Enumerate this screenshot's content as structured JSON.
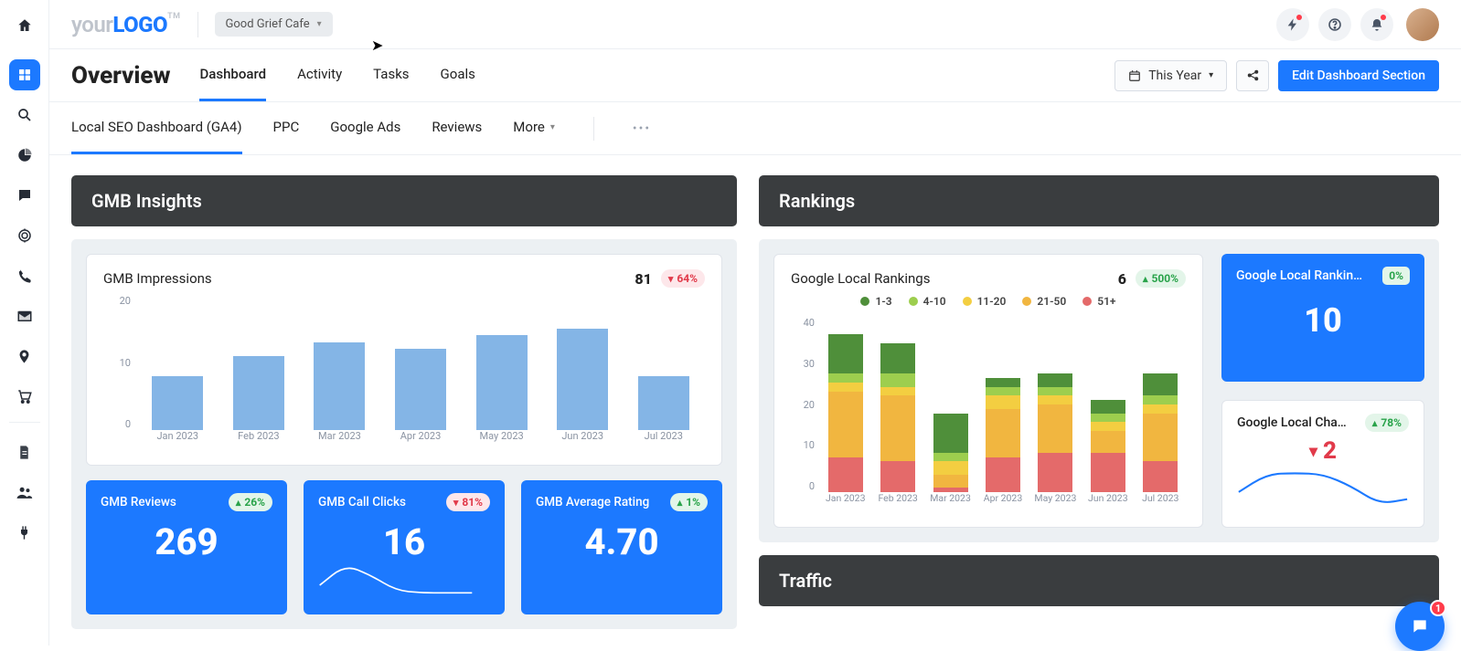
{
  "brand": {
    "part1": "your",
    "part2": "LOGO",
    "tm": "TM"
  },
  "client_selector": {
    "label": "Good Grief Cafe"
  },
  "topbar": {
    "notifications_badge": "1"
  },
  "secbar": {
    "title": "Overview",
    "tabs": [
      "Dashboard",
      "Activity",
      "Tasks",
      "Goals"
    ],
    "date_range": "This Year",
    "edit_btn": "Edit Dashboard Section"
  },
  "tertbar": {
    "tabs": [
      "Local SEO Dashboard (GA4)",
      "PPC",
      "Google Ads",
      "Reviews",
      "More"
    ]
  },
  "sections": {
    "gmb": {
      "title": "GMB Insights"
    },
    "rankings": {
      "title": "Rankings"
    },
    "traffic": {
      "title": "Traffic"
    }
  },
  "gmb_impressions": {
    "title": "GMB Impressions",
    "value": "81",
    "delta": "64%",
    "delta_dir": "down"
  },
  "gmb_stats": {
    "reviews": {
      "title": "GMB Reviews",
      "value": "269",
      "delta": "26%",
      "delta_dir": "up"
    },
    "calls": {
      "title": "GMB Call Clicks",
      "value": "16",
      "delta": "81%",
      "delta_dir": "down"
    },
    "rating": {
      "title": "GMB Average Rating",
      "value": "4.70",
      "delta": "1%",
      "delta_dir": "up"
    }
  },
  "rankings_chart": {
    "title": "Google Local Rankings",
    "value": "6",
    "delta": "500%",
    "delta_dir": "up"
  },
  "rank_cards": {
    "top": {
      "title": "Google Local Rankings",
      "value": "10",
      "pct": "0%"
    },
    "bottom": {
      "title": "Google Local Cha…",
      "value": "2",
      "delta": "78%",
      "delta_dir": "up"
    }
  },
  "legend": {
    "items": [
      {
        "label": "1-3",
        "color": "#4f8f3a"
      },
      {
        "label": "4-10",
        "color": "#9dce4e"
      },
      {
        "label": "11-20",
        "color": "#f3ce41"
      },
      {
        "label": "21-50",
        "color": "#f1b640"
      },
      {
        "label": "51+",
        "color": "#e46a6a"
      }
    ]
  },
  "chart_data": [
    {
      "id": "gmb_impressions",
      "type": "bar",
      "title": "GMB Impressions",
      "ylim": [
        0,
        20
      ],
      "yticks": [
        20,
        10,
        0
      ],
      "categories": [
        "Jan 2023",
        "Feb 2023",
        "Mar 2023",
        "Apr 2023",
        "May 2023",
        "Jun 2023",
        "Jul 2023"
      ],
      "values": [
        8,
        11,
        13,
        12,
        14,
        15,
        8
      ]
    },
    {
      "id": "google_local_rankings",
      "type": "stacked-bar",
      "title": "Google Local Rankings",
      "ylim": [
        0,
        40
      ],
      "yticks": [
        40,
        30,
        20,
        10,
        0
      ],
      "categories": [
        "Jan 2023",
        "Feb 2023",
        "Mar 2023",
        "Apr 2023",
        "May 2023",
        "Jun 2023",
        "Jul 2023"
      ],
      "series": [
        {
          "name": "51+",
          "color": "#e46a6a",
          "values": [
            8,
            7,
            1,
            8,
            9,
            9,
            7
          ]
        },
        {
          "name": "21-50",
          "color": "#f1b640",
          "values": [
            15,
            15,
            3,
            11,
            11,
            5,
            11
          ]
        },
        {
          "name": "11-20",
          "color": "#f3ce41",
          "values": [
            2,
            2,
            3,
            3,
            2,
            2,
            2
          ]
        },
        {
          "name": "4-10",
          "color": "#9dce4e",
          "values": [
            2,
            3,
            2,
            2,
            2,
            2,
            2
          ]
        },
        {
          "name": "1-3",
          "color": "#4f8f3a",
          "values": [
            9,
            7,
            9,
            2,
            3,
            3,
            5
          ]
        }
      ]
    },
    {
      "id": "gmb_call_clicks_spark",
      "type": "line",
      "x": [
        0,
        1,
        2,
        3,
        4,
        5,
        6
      ],
      "values": [
        2,
        6,
        4,
        1,
        0.5,
        0.5,
        0.5
      ]
    },
    {
      "id": "google_local_change_spark",
      "type": "line",
      "x": [
        0,
        1,
        2,
        3,
        4,
        5,
        6
      ],
      "values": [
        0.3,
        0.6,
        0.62,
        0.6,
        0.4,
        0.1,
        0.18
      ]
    }
  ]
}
